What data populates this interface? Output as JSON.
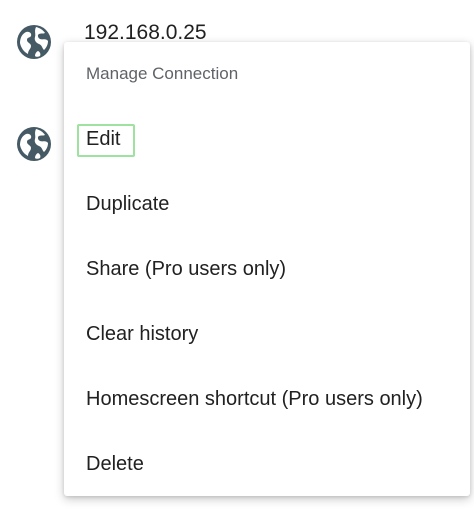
{
  "background_list": {
    "items": [
      {
        "icon": "globe-icon",
        "host": "192.168.0.25"
      },
      {
        "icon": "globe-icon",
        "host": ""
      }
    ]
  },
  "menu": {
    "title": "Manage Connection",
    "items": [
      {
        "label": "Edit",
        "focused": true
      },
      {
        "label": "Duplicate"
      },
      {
        "label": "Share (Pro users only)"
      },
      {
        "label": "Clear history"
      },
      {
        "label": "Homescreen shortcut (Pro users only)"
      },
      {
        "label": "Delete"
      }
    ]
  },
  "colors": {
    "icon": "#455a64",
    "text": "#212121",
    "title": "#5f6368",
    "focus_outline": "#9fe29f"
  }
}
